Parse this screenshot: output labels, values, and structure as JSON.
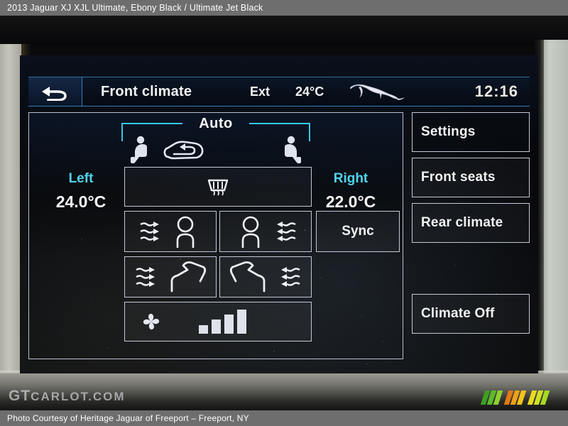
{
  "caption": {
    "top": "2013 Jaguar XJ XJL Ultimate,   Ebony Black / Ultimate Jet Black",
    "bottom": "Photo Courtesy of Heritage Jaguar of Freeport – Freeport, NY"
  },
  "watermark": {
    "brand_lead": "GT",
    "brand_rest": "CARLOT.COM"
  },
  "header": {
    "back_icon": "back-arrow-icon",
    "title": "Front climate",
    "ext_label": "Ext",
    "ext_temp": "24°C",
    "brand_icon": "jaguar-leaper-icon",
    "clock": "12:16"
  },
  "climate": {
    "auto_label": "Auto",
    "left": {
      "label": "Left",
      "value": "24.0°C"
    },
    "right": {
      "label": "Right",
      "value": "22.0°C"
    },
    "icons": {
      "seat_left": "driver-seat-icon",
      "seat_right": "passenger-seat-icon",
      "recirculate": "air-recirculation-icon",
      "defrost": "windshield-defrost-icon",
      "face_left": "face-vent-left-icon",
      "face_right": "face-vent-right-icon",
      "foot_left": "footwell-vent-left-icon",
      "foot_right": "footwell-vent-right-icon",
      "fan": "fan-blower-icon"
    },
    "sync_label": "Sync",
    "fan_speed": {
      "level": 4,
      "max": 4
    }
  },
  "menu": {
    "settings": "Settings",
    "front_seats": "Front seats",
    "rear_climate": "Rear climate",
    "climate_off": "Climate Off"
  },
  "colors": {
    "accent_cyan": "#4fd4ef",
    "header_rule": "#2f7fc4",
    "text_primary": "#f2f2f2",
    "button_border": "#c4c8d8",
    "caption_bar": "#6e6e6e"
  }
}
